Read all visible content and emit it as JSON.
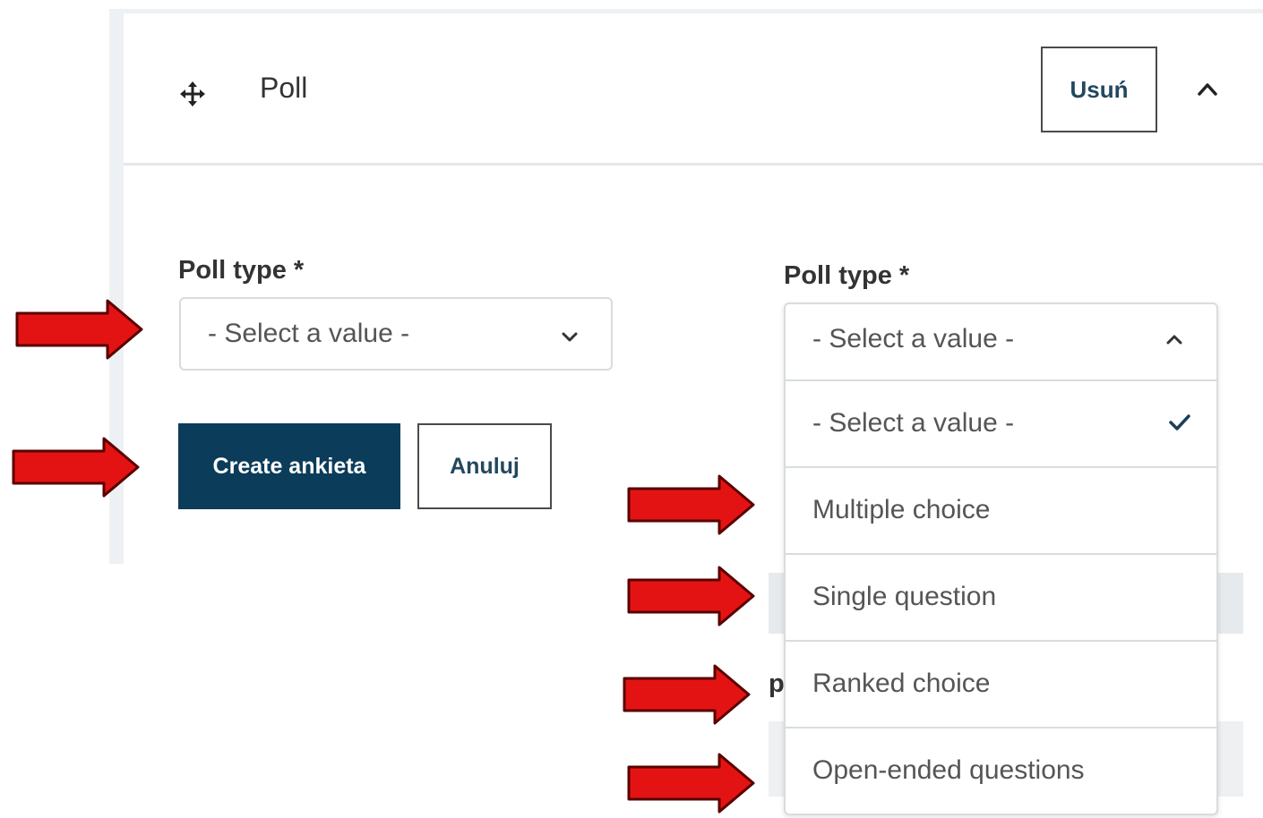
{
  "header": {
    "title": "Poll",
    "remove_label": "Usuń"
  },
  "form_left": {
    "label": "Poll type *",
    "select_value": "- Select a value -",
    "create_label": "Create ankieta",
    "cancel_label": "Anuluj"
  },
  "form_right": {
    "label": "Poll type *",
    "select_value": "- Select a value -",
    "options": [
      "- Select a value -",
      "Multiple choice",
      "Single question",
      "Ranked choice",
      "Open-ended questions"
    ],
    "selected_index": 0
  },
  "background_fragment": "p",
  "colors": {
    "arrow_fill": "#e41313",
    "arrow_stroke": "#5a0000",
    "primary": "#0b3c5a"
  },
  "icons": [
    "drag-handle-icon",
    "chevron-up-icon",
    "chevron-down-icon",
    "checkmark-icon",
    "red-arrow-icon"
  ]
}
